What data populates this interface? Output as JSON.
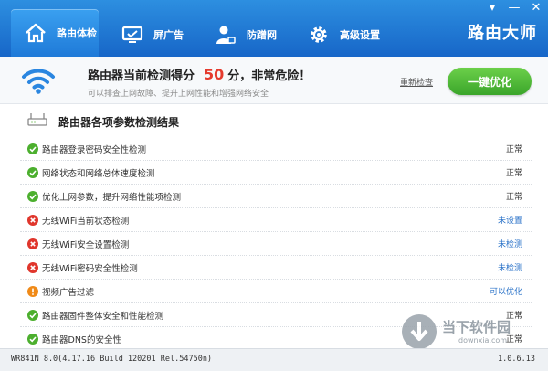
{
  "window": {
    "brand": "路由大师",
    "controls": [
      "▾",
      "—",
      "✕"
    ]
  },
  "tabs": [
    {
      "label": "路由体检",
      "icon": "home-icon",
      "active": true
    },
    {
      "label": "屏广告",
      "icon": "monitor-icon",
      "active": false
    },
    {
      "label": "防蹭网",
      "icon": "user-lock-icon",
      "active": false
    },
    {
      "label": "高级设置",
      "icon": "gear-icon",
      "active": false
    }
  ],
  "banner": {
    "score_prefix": "路由器当前检测得分",
    "score_value": "50",
    "score_suffix": "分，非常危险！",
    "subtitle": "可以排查上网故障、提升上网性能和增强网络安全",
    "recheck_label": "重新检查",
    "optimize_label": "一键优化"
  },
  "results": {
    "title": "路由器各项参数检测结果",
    "items": [
      {
        "label": "路由器登录密码安全性检测",
        "status": "ok",
        "value": "正常"
      },
      {
        "label": "网络状态和网络总体速度检测",
        "status": "ok",
        "value": "正常"
      },
      {
        "label": "优化上网参数，提升网络性能项检测",
        "status": "ok",
        "value": "正常"
      },
      {
        "label": "无线WiFi当前状态检测",
        "status": "error",
        "value": "未设置"
      },
      {
        "label": "无线WiFi安全设置检测",
        "status": "error",
        "value": "未检测"
      },
      {
        "label": "无线WiFi密码安全性检测",
        "status": "error",
        "value": "未检测"
      },
      {
        "label": "视频广告过滤",
        "status": "warn",
        "value": "可以优化"
      },
      {
        "label": "路由器固件整体安全和性能检测",
        "status": "ok",
        "value": "正常"
      },
      {
        "label": "路由器DNS的安全性",
        "status": "ok",
        "value": "正常"
      }
    ]
  },
  "statusbar": {
    "left": "WR841N 8.0(4.17.16 Build 120201 Rel.54750n)",
    "right": "1.0.6.13"
  },
  "watermark": {
    "text": "当下软件园",
    "sub": "downxia.com"
  },
  "colors": {
    "ok": "#4caf2e",
    "error": "#e0362c",
    "warn": "#f08a18",
    "link": "#2a72c8",
    "accent": "#1f7ad8"
  }
}
